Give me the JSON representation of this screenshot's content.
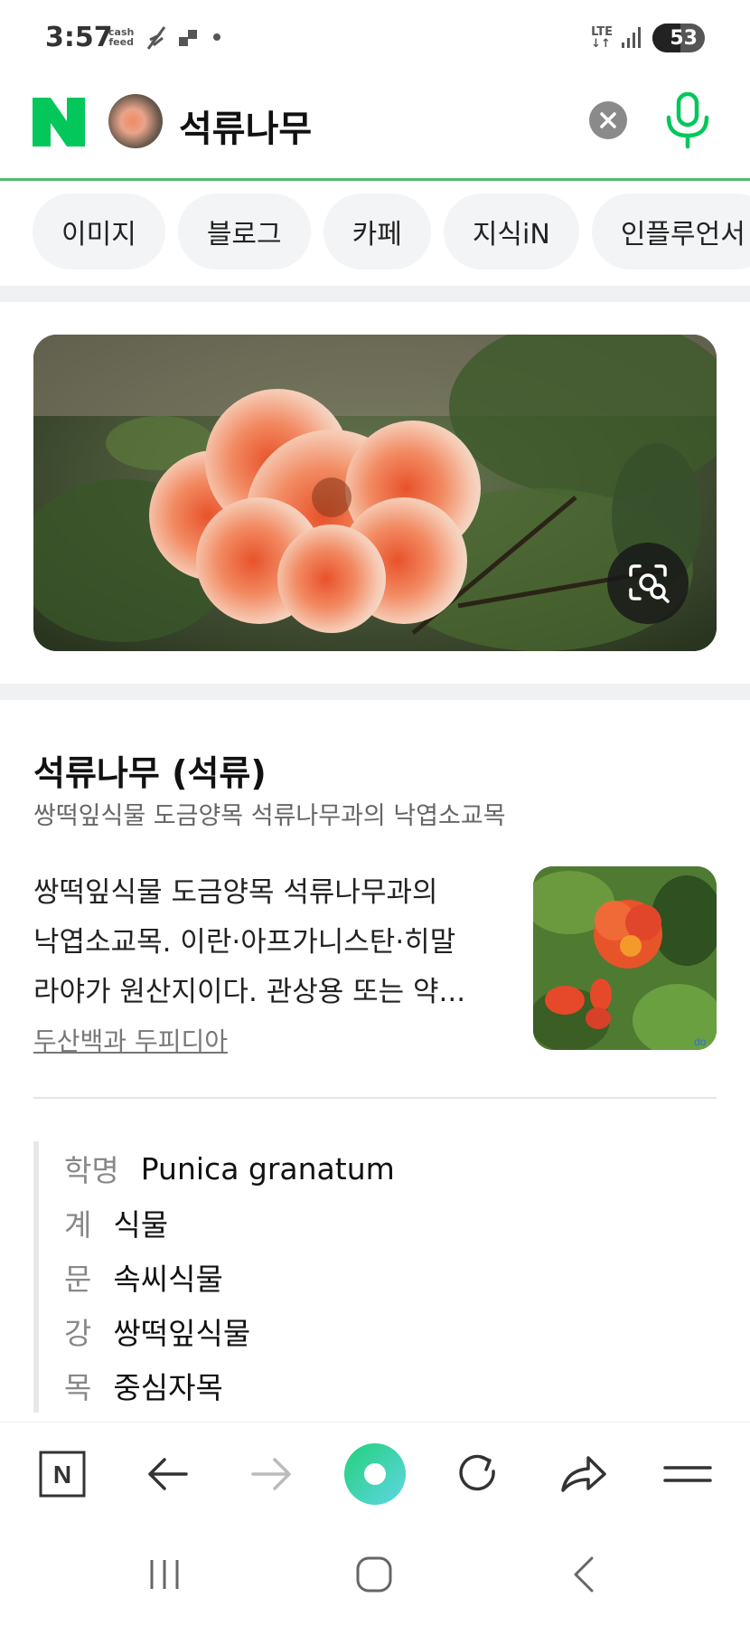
{
  "status_bar": {
    "time": "3:57",
    "app_badge": "cash\nfeed",
    "network": "LTE",
    "battery": "53",
    "battery_level": 0.53
  },
  "search": {
    "query": "석류나무",
    "logo_letter": "N",
    "accent_color": "#03c75a"
  },
  "tabs": [
    {
      "label": "이미지"
    },
    {
      "label": "블로그"
    },
    {
      "label": "카페"
    },
    {
      "label": "지식iN"
    },
    {
      "label": "인플루언서"
    }
  ],
  "info": {
    "title": "석류나무 (석류)",
    "subtitle": "쌍떡잎식물 도금양목 석류나무과의 낙엽소교목",
    "description_lines": [
      "쌍떡잎식물 도금양목 석류나무과의",
      "낙엽소교목. 이란·아프가니스탄·히말",
      "라야가 원산지이다. 관상용 또는 약..."
    ],
    "source": "두산백과 두피디아",
    "thumb_watermark": "do"
  },
  "classification": [
    {
      "key": "학명",
      "value": "Punica granatum"
    },
    {
      "key": "계",
      "value": "식물"
    },
    {
      "key": "문",
      "value": "속씨식물"
    },
    {
      "key": "강",
      "value": "쌍떡잎식물"
    },
    {
      "key": "목",
      "value": "중심자목"
    }
  ],
  "toolbar": {
    "home_letter": "N"
  }
}
